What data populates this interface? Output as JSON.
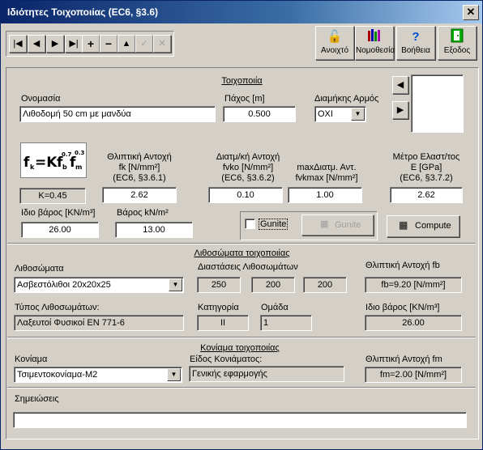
{
  "window": {
    "title": "Ιδιότητες Τοιχοποιίας (EC6, §3.6)",
    "close": "✕"
  },
  "toolbar": {
    "nav": [
      "|◀",
      "◀",
      "▶",
      "▶|",
      "+",
      "−",
      "▲",
      "✓",
      "✕"
    ],
    "buttons": [
      {
        "label": "Ανοιχτό",
        "icon": "lock-icon"
      },
      {
        "label": "Νομοθεσία",
        "icon": "books-icon"
      },
      {
        "label": "Βοήθεια",
        "icon": "help-icon"
      },
      {
        "label": "Εξοδος",
        "icon": "exit-icon"
      }
    ]
  },
  "masonry": {
    "section_title": "Τοιχοποιία",
    "name_label": "Ονομασία",
    "name_value": "Λιθοδομή 50 cm με μανδύα",
    "thickness_label": "Πάχος [m]",
    "thickness_value": "0.500",
    "joint_label": "Διαμήκης Αρμός",
    "joint_value": "ΟΧΙ",
    "formula": "fk=K fb0.7 fm0.3",
    "k_value": "K=0.45",
    "fk_label": "Θλιπτική Αντοχή",
    "fk_label2": "fk [N/mm²]",
    "fk_label3": "(EC6, §3.6.1)",
    "fk_value": "2.62",
    "fvko_label": "Διατμ/κή Αντοχή",
    "fvko_label2": "fvko [N/mm²]",
    "fvko_label3": "(EC6, §3.6.2)",
    "fvko_value": "0.10",
    "fvkmax_label": "maxΔιατμ. Αντ.",
    "fvkmax_label2": "fvkmax [N/mm²]",
    "fvkmax_value": "1.00",
    "e_label": "Μέτρο Ελαστ/τος",
    "e_label2": "E [GPa]",
    "e_label3": "(EC6, §3.7.2)",
    "e_value": "2.62",
    "self_weight_label": "Ιδιο βάρος [KN/m³]",
    "self_weight_value": "26.00",
    "weight_label": "Βάρος kN/m²",
    "weight_value": "13.00",
    "gunite_check_label": "Gunite",
    "gunite_button": "Gunite",
    "compute_button": "Compute"
  },
  "units": {
    "section_title": "Λιθοσώματα τοιχοποιίας",
    "units_label": "Λιθοσώματα",
    "units_value": "Ασβεστόλιθοι 20x20x25",
    "dims_label": "Διαστάσεις Λιθοσωμάτων",
    "dims": [
      "250",
      "200",
      "200"
    ],
    "fb_label": "Θλιπτική Αντοχή fb",
    "fb_value": "fb=9.20  [N/mm²]",
    "type_label": "Τύπος Λιθοσωμάτων:",
    "type_value": "Λαξευτοί Φυσικοί  EN 771-6",
    "category_label": "Κατηγορία",
    "category_value": "II",
    "group_label": "Ομάδα",
    "group_value": "1",
    "unit_weight_label": "Ιδιο βάρος [KN/m³]",
    "unit_weight_value": "26.00"
  },
  "mortar": {
    "section_title": "Κονίαμα τοιχοποιίας",
    "mortar_label": "Κονίαμα",
    "mortar_value": "Τσιμεντοκονίαμα-M2",
    "kind_label": "Είδος Κονιάματος:",
    "kind_value": "Γενικής εφαρμογής",
    "fm_label": "Θλιπτική Αντοχή fm",
    "fm_value": "fm=2.00  [N/mm²]"
  },
  "notes": {
    "label": "Σημειώσεις",
    "value": ""
  }
}
